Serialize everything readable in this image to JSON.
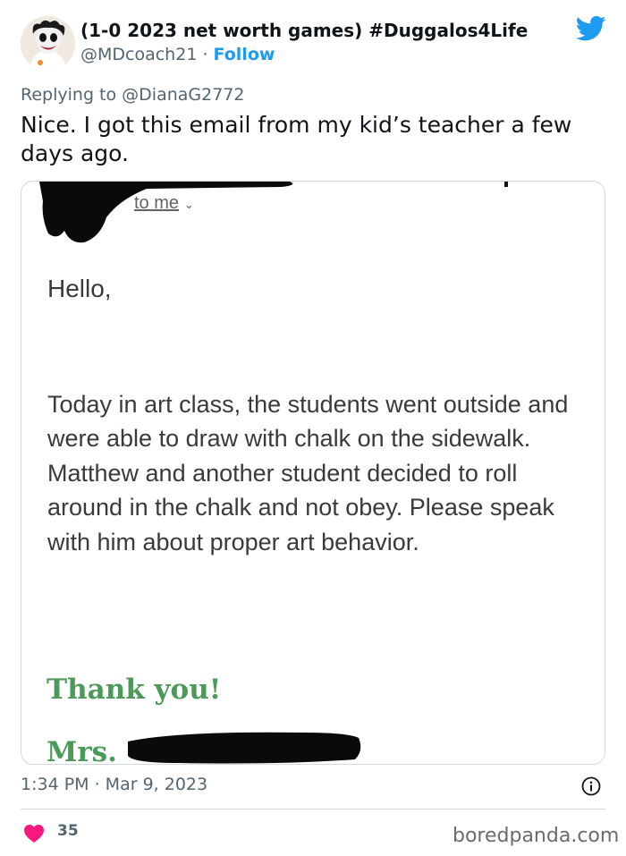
{
  "tweet": {
    "display_name": "(1-0 2023 net worth games) #Duggalos4Life",
    "handle": "@MDcoach21",
    "separator": " · ",
    "follow_label": "Follow",
    "replying_prefix": "Replying to ",
    "replying_mention": "@DianaG2772",
    "text": "Nice. I got this email from my kid’s teacher a few days ago.",
    "time": "1:34 PM · Mar 9, 2023",
    "likes": "35"
  },
  "email": {
    "recipient": "to me",
    "greeting": "Hello,",
    "body": "Today in art class, the students went outside and were able to draw with chalk on the sidewalk. Matthew and another student decided to roll around in the chalk and not obey. Please speak with him about proper art behavior.",
    "thanks": "Thank you!",
    "signature_prefix": "Mrs."
  },
  "watermark": "boredpanda.com",
  "icons": {
    "brand": "twitter-bird-icon",
    "info": "info-icon",
    "like": "heart-icon",
    "menu": "chevron-down-icon"
  },
  "colors": {
    "twitter_blue": "#1d9bf0",
    "like_pink": "#f91880",
    "signature_green": "#4c9a5a",
    "muted_text": "#536471"
  }
}
